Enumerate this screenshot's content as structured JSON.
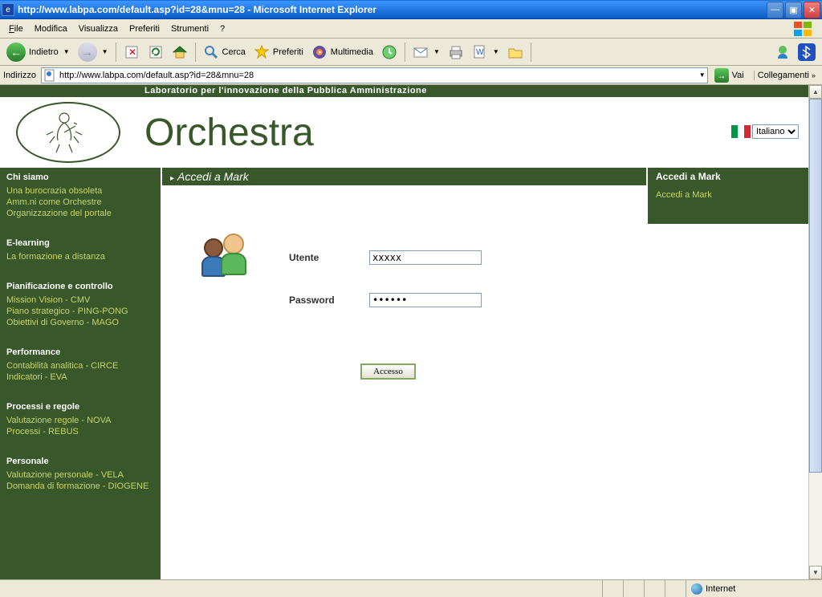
{
  "window": {
    "title": "http://www.labpa.com/default.asp?id=28&mnu=28 - Microsoft Internet Explorer"
  },
  "menu": {
    "file": "File",
    "edit": "Modifica",
    "view": "Visualizza",
    "favorites": "Preferiti",
    "tools": "Strumenti",
    "help": "?"
  },
  "toolbar": {
    "back": "Indietro",
    "search": "Cerca",
    "favorites": "Preferiti",
    "multimedia": "Multimedia"
  },
  "address": {
    "label": "Indirizzo",
    "value": "http://www.labpa.com/default.asp?id=28&mnu=28",
    "go": "Vai",
    "links": "Collegamenti"
  },
  "tagline": "Laboratorio per l'innovazione della Pubblica Amministrazione",
  "brand": "Orchestra",
  "language": "Italiano",
  "nav": {
    "sections": [
      {
        "heading": "Chi siamo",
        "items": [
          "Una burocrazia obsoleta",
          "Amm.ni come Orchestre",
          "Organizzazione del portale"
        ]
      },
      {
        "heading": "E-learning",
        "items": [
          "La formazione a distanza"
        ]
      },
      {
        "heading": "Pianificazione e controllo",
        "items": [
          "Mission Vision - CMV",
          "Piano strategico - PING-PONG",
          "Obiettivi di Governo - MAGO"
        ]
      },
      {
        "heading": "Performance",
        "items": [
          "Contabilità analitica - CIRCE",
          "Indicatori - EVA"
        ]
      },
      {
        "heading": "Processi e regole",
        "items": [
          "Valutazione regole - NOVA",
          "Processi - REBUS"
        ]
      },
      {
        "heading": "Personale",
        "items": [
          "Valutazione personale - VELA",
          "Domanda di formazione - DIOGENE"
        ]
      }
    ]
  },
  "login": {
    "title": "Accedi a Mark",
    "user_label": "Utente",
    "pass_label": "Password",
    "user_value": "xxxxx",
    "pass_value": "••••••",
    "submit": "Accesso"
  },
  "right": {
    "heading": "Accedi a Mark",
    "link": "Accedi a Mark"
  },
  "status": {
    "zone": "Internet"
  }
}
